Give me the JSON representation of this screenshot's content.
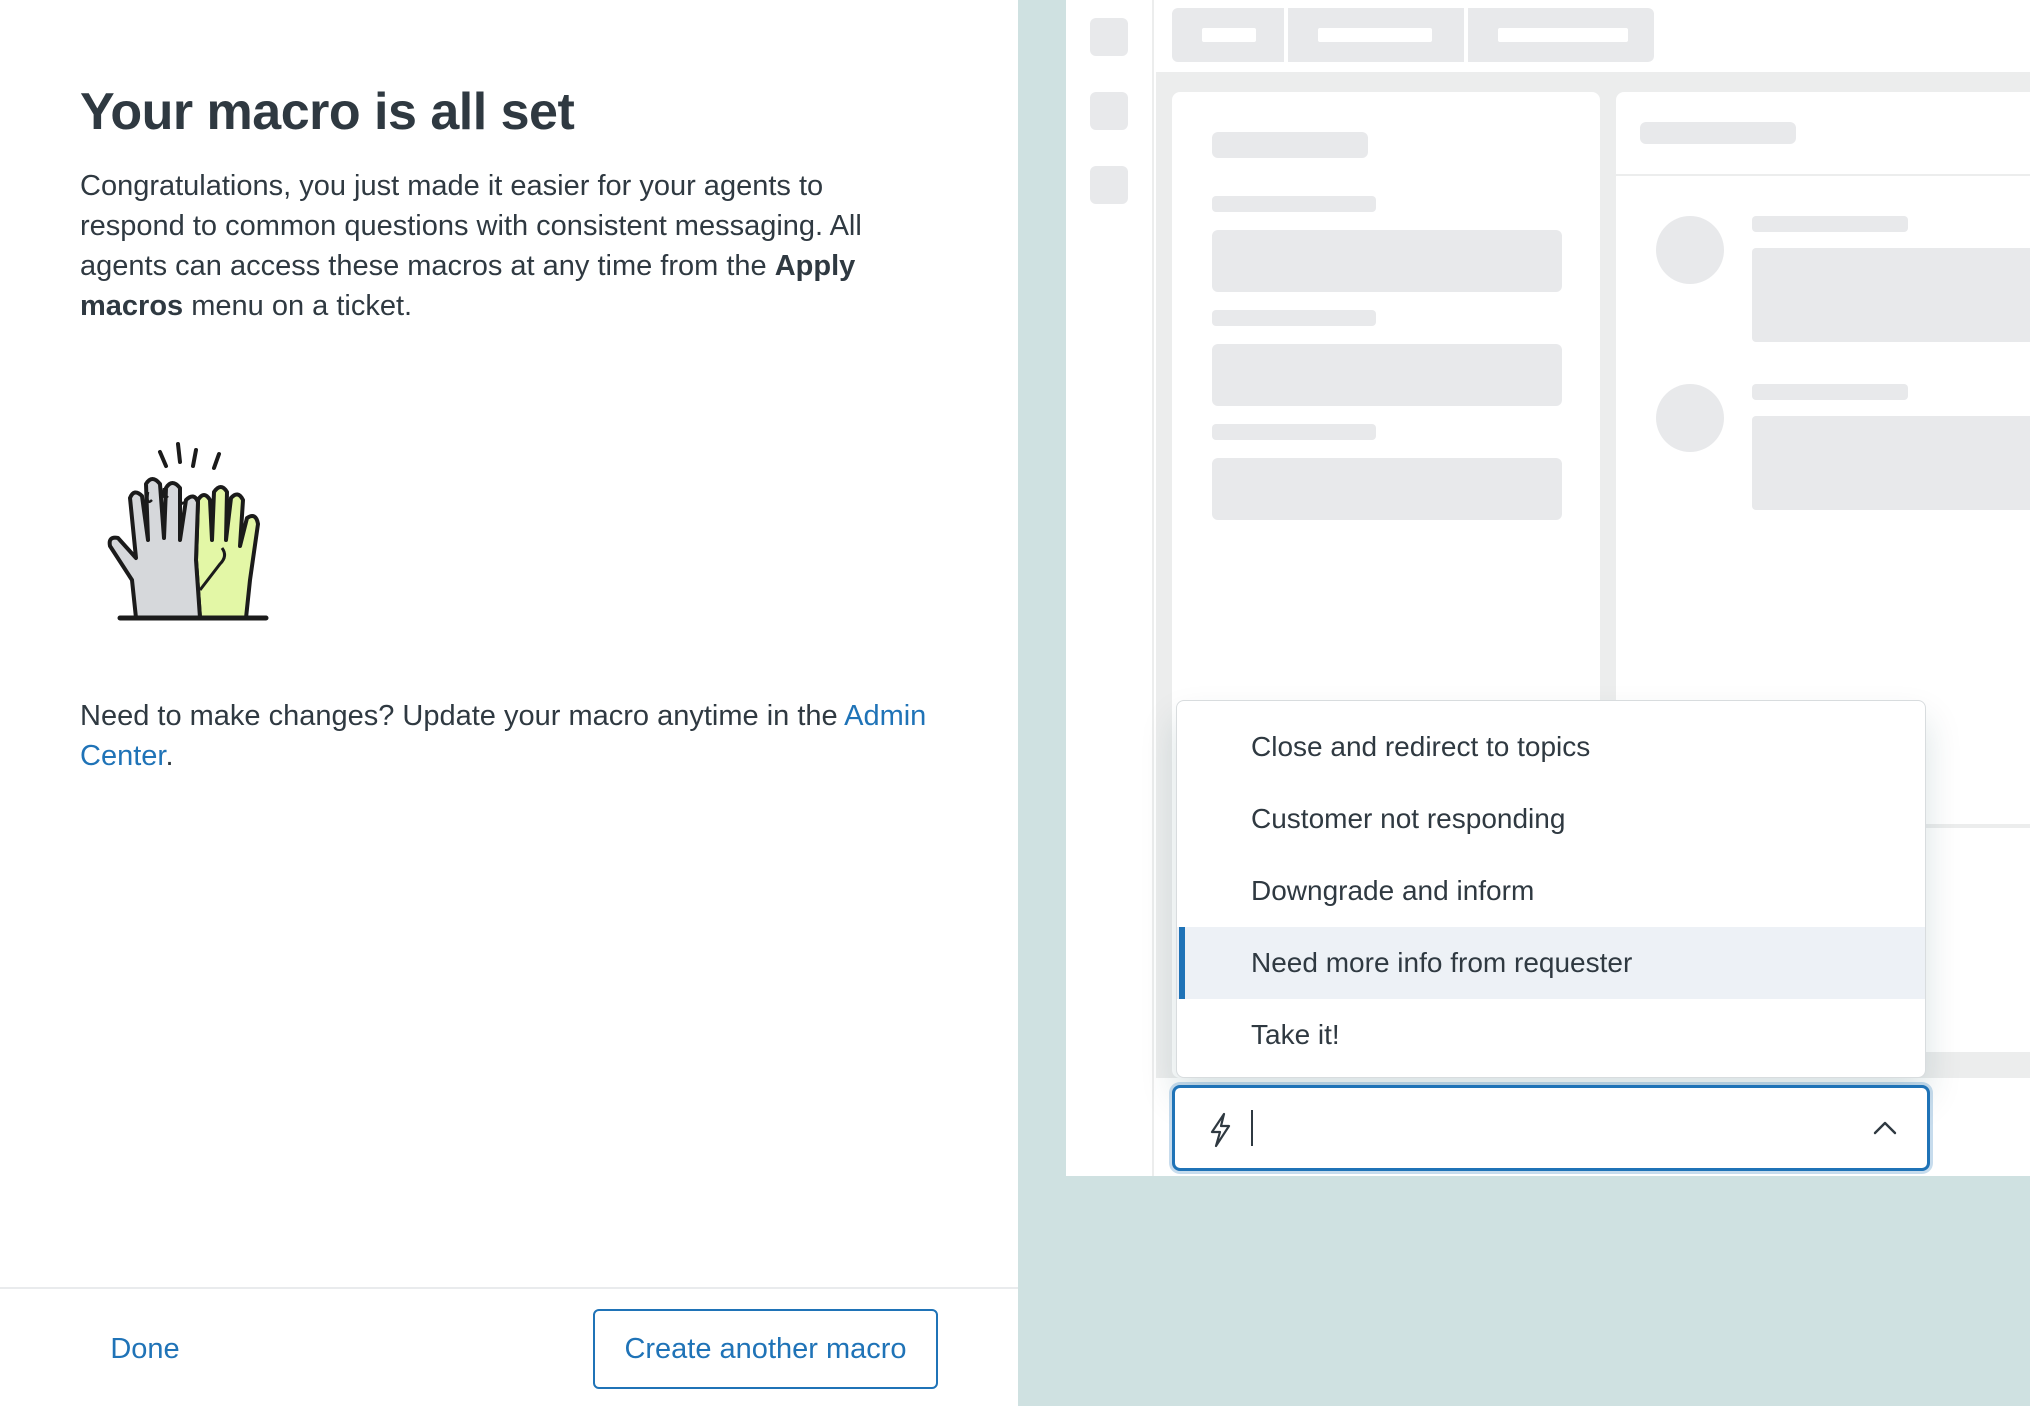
{
  "dialog": {
    "title": "Your macro is all set",
    "description_part1": "Congratulations, you just made it easier for your agents to respond to common questions with consistent messaging. All agents can access these macros at any time from the ",
    "description_bold": "Apply macros",
    "description_part2": " menu on a ticket.",
    "illustration": "high-five-hands-illustration",
    "changes_text": "Need to make changes? Update your macro anytime in the ",
    "changes_link": "Admin Center",
    "changes_end": ".",
    "done_label": "Done",
    "create_label": "Create another macro"
  },
  "preview": {
    "macro_menu": {
      "items": [
        "Close and redirect to topics",
        "Customer not responding",
        "Downgrade and inform",
        "Need more info from requester",
        "Take it!"
      ],
      "active_index": 3
    },
    "combobox": {
      "icon": "lightning-bolt-icon",
      "value": "",
      "expanded_icon": "chevron-up-icon"
    }
  },
  "colors": {
    "accent": "#1f73b7",
    "text": "#2f3941",
    "preview_background": "#cfe1e1",
    "skeleton": "#e8e9eb",
    "highlight": "#edf1f6",
    "hand_highlight": "#e3f7a6"
  }
}
